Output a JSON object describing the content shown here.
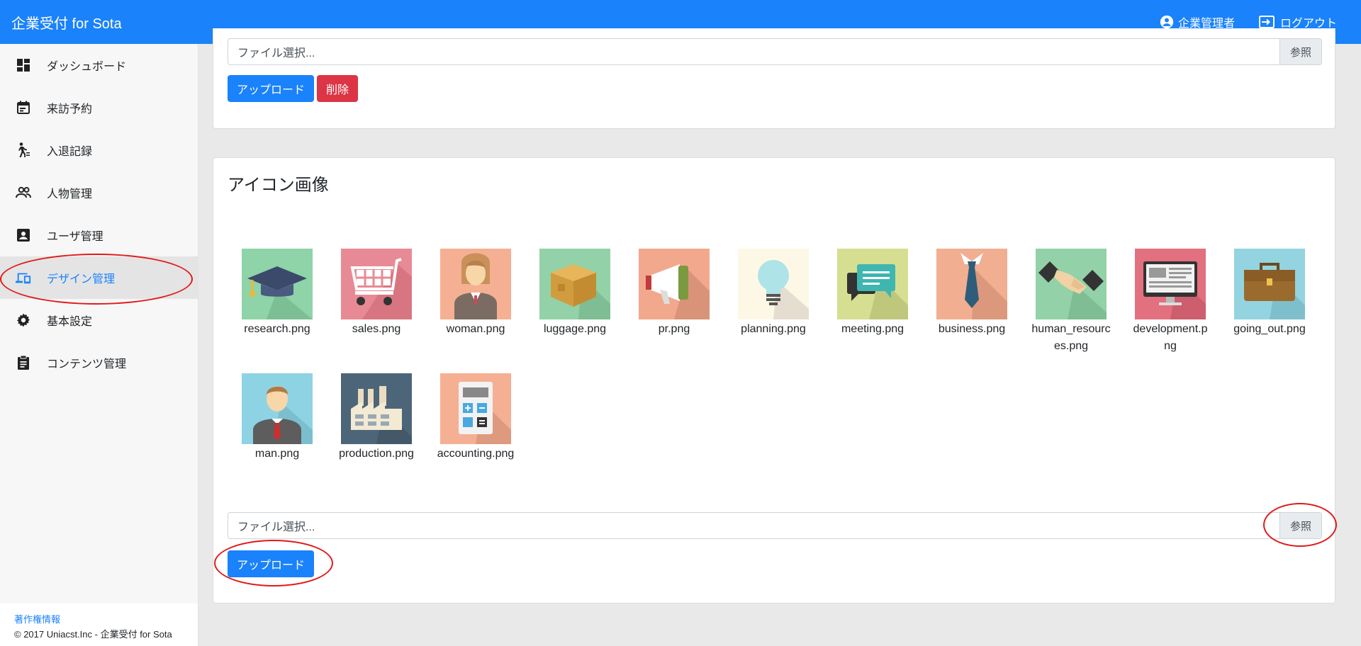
{
  "header": {
    "title": "企業受付 for Sota",
    "user_label": "企業管理者",
    "logout_label": "ログアウト"
  },
  "sidebar": {
    "items": [
      {
        "label": "ダッシュボード",
        "icon": "dashboard-icon"
      },
      {
        "label": "来訪予約",
        "icon": "calendar-icon"
      },
      {
        "label": "入退記録",
        "icon": "walk-icon"
      },
      {
        "label": "人物管理",
        "icon": "people-icon"
      },
      {
        "label": "ユーザ管理",
        "icon": "account-box-icon"
      },
      {
        "label": "デザイン管理",
        "icon": "devices-icon",
        "active": true
      },
      {
        "label": "基本設定",
        "icon": "gear-icon"
      },
      {
        "label": "コンテンツ管理",
        "icon": "clipboard-icon"
      }
    ],
    "footer": {
      "link": "著作権情報",
      "copyright": "© 2017 Uniacst.Inc - 企業受付 for Sota"
    }
  },
  "top_panel": {
    "file_placeholder": "ファイル選択...",
    "browse_label": "参照",
    "upload_label": "アップロード",
    "delete_label": "削除"
  },
  "icon_panel": {
    "title": "アイコン画像",
    "icons": [
      {
        "name": "research.png",
        "bg": "#8fd3a8",
        "icon": "graduation-cap-icon"
      },
      {
        "name": "sales.png",
        "bg": "#e88a95",
        "icon": "shopping-cart-icon"
      },
      {
        "name": "woman.png",
        "bg": "#f5b093",
        "icon": "woman-icon"
      },
      {
        "name": "luggage.png",
        "bg": "#93d1a8",
        "icon": "box-icon"
      },
      {
        "name": "pr.png",
        "bg": "#f2a88d",
        "icon": "megaphone-icon"
      },
      {
        "name": "planning.png",
        "bg": "#fdf8e6",
        "icon": "lightbulb-icon"
      },
      {
        "name": "meeting.png",
        "bg": "#d6df91",
        "icon": "chat-bubble-icon"
      },
      {
        "name": "business.png",
        "bg": "#f2ae91",
        "icon": "necktie-icon"
      },
      {
        "name": "human_resources.png",
        "bg": "#93d1a8",
        "icon": "handshake-icon"
      },
      {
        "name": "development.png",
        "bg": "#e3707f",
        "icon": "monitor-icon"
      },
      {
        "name": "going_out.png",
        "bg": "#93d4e0",
        "icon": "briefcase-icon"
      },
      {
        "name": "man.png",
        "bg": "#8ed3e3",
        "icon": "man-icon"
      },
      {
        "name": "production.png",
        "bg": "#4d6578",
        "icon": "factory-icon"
      },
      {
        "name": "accounting.png",
        "bg": "#f5b093",
        "icon": "calculator-icon"
      }
    ],
    "file_placeholder": "ファイル選択...",
    "browse_label": "参照",
    "upload_label": "アップロード"
  }
}
